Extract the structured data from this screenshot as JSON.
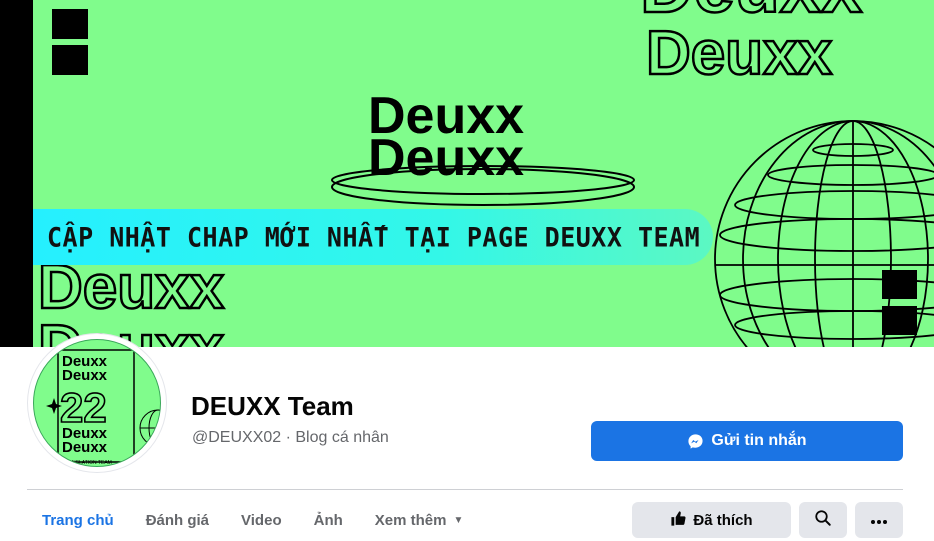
{
  "cover": {
    "brand_lines": [
      "Deuxx",
      "Deuxx"
    ],
    "outline_word": "Deuxx",
    "banner_text": "CẬP NHẬT CHAP MỚI NHẤT TẠI PAGE DEUXX TEAM",
    "background_color": "#80fc8c",
    "banner_color": "#25f0ff"
  },
  "avatar": {
    "lines_top": [
      "Deuxx",
      "Deuxx"
    ],
    "number": "22",
    "lines_bottom": [
      "Deuxx",
      "Deuxx"
    ],
    "caption": "TRANSLATION TEAM"
  },
  "profile": {
    "name": "DEUXX Team",
    "handle": "@DEUXX02 · Blog cá nhân"
  },
  "actions": {
    "message_label": "Gửi tin nhắn",
    "like_label": "Đã thích",
    "accent_color": "#1b74e4"
  },
  "tabs": [
    {
      "label": "Trang chủ",
      "active": true
    },
    {
      "label": "Đánh giá",
      "active": false
    },
    {
      "label": "Video",
      "active": false
    },
    {
      "label": "Ảnh",
      "active": false
    },
    {
      "label": "Xem thêm",
      "active": false
    }
  ],
  "icons": {
    "message": "messenger-icon",
    "like": "thumbs-up-icon",
    "search": "search-icon",
    "more": "more-horizontal-icon",
    "dropdown": "caret-down-icon"
  }
}
